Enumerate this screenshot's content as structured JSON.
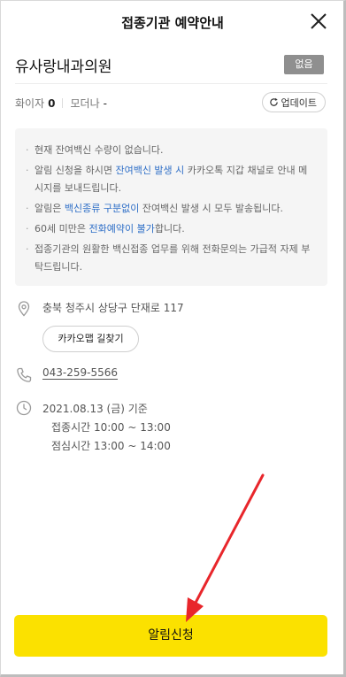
{
  "header": {
    "title": "접종기관 예약안내",
    "close_icon": "close-icon"
  },
  "facility": {
    "name": "유사랑내과의원",
    "stock_badge": "없음"
  },
  "counts": {
    "pfizer_label": "화이자",
    "pfizer_value": "0",
    "moderna_label": "모더나",
    "moderna_value": "-"
  },
  "refresh": {
    "label": "업데이트",
    "icon": "refresh-icon"
  },
  "notice": {
    "item1": "현재 잔여백신 수량이 없습니다.",
    "item2_pre": "알림 신청을 하시면 ",
    "item2_hl": "잔여백신 발생 시",
    "item2_post": " 카카오톡 지갑 채널로 안내 메시지를 보내드립니다.",
    "item3_pre": "알림은 ",
    "item3_hl": "백신종류 구분없이",
    "item3_post": " 잔여백신 발생 시 모두 발송됩니다.",
    "item4_pre": "60세 미만은 ",
    "item4_hl": "전화예약이 불가",
    "item4_post": "합니다.",
    "item5": "접종기관의 원활한 백신접종 업무를 위해 전화문의는 가급적 자제 부탁드립니다."
  },
  "address": {
    "text": "충북 청주시 상당구 단재로 117",
    "map_button": "카카오맵 길찾기"
  },
  "phone": {
    "number": "043-259-5566"
  },
  "hours": {
    "date": "2021.08.13 (금) 기준",
    "vaccination": "접종시간 10:00 ~ 13:00",
    "lunch": "점심시간 13:00 ~ 14:00"
  },
  "cta": {
    "label": "알림신청"
  },
  "colors": {
    "accent_yellow": "#fbe100",
    "highlight_blue": "#2f6fc7",
    "annotation_red": "#e8262b"
  }
}
